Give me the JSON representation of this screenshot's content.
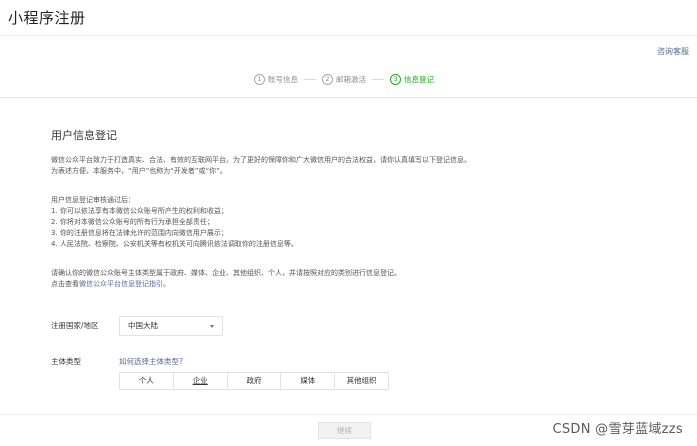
{
  "header": {
    "title": "小程序注册",
    "support_link": "咨询客服"
  },
  "steps": [
    {
      "num": "1",
      "label": "账号信息"
    },
    {
      "num": "2",
      "label": "邮箱激活"
    },
    {
      "num": "3",
      "label": "信息登记"
    }
  ],
  "main": {
    "section_title": "用户信息登记",
    "intro_lines": [
      "微信公众平台致力于打造真实、合法、有效的互联网平台。为了更好的保障你和广大微信用户的合法权益，请你认真填写以下登记信息。",
      "为表述方便，本服务中，“用户”也称为“开发者”或“你”。"
    ],
    "rights_lines": [
      "用户信息登记审核通过后：",
      "1. 你可以依法享有本微信公众账号所产生的权利和收益；",
      "2. 你将对本微信公众账号的所有行为承担全部责任；",
      "3. 你的注册信息将在法律允许的范围内向微信用户展示；",
      "4. 人民法院、检察院、公安机关等有权机关可向腾讯依法调取你的注册信息等。"
    ],
    "confirm_line": "请确认你的微信公众账号主体类型属于政府、媒体、企业、其他组织、个人，并请按照对应的类别进行信息登记。",
    "guide_prefix": "点击查看",
    "guide_link": "微信公众平台信息登记指引",
    "guide_suffix": "。"
  },
  "form": {
    "region_label": "注册国家/地区",
    "region_value": "中国大陆",
    "type_label": "主体类型",
    "type_help_link": "如何选择主体类型?",
    "type_options": [
      "个人",
      "企业",
      "政府",
      "媒体",
      "其他组织"
    ]
  },
  "actions": {
    "continue_label": "继续"
  },
  "watermark": "CSDN @雪芽蓝域zzs"
}
